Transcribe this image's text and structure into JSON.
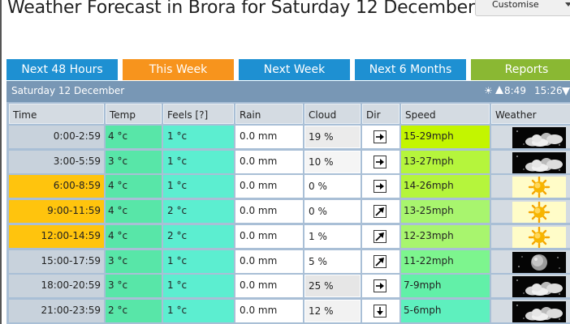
{
  "page": {
    "title": "Weather Forecast in Brora for Saturday 12 December",
    "customise_label": "Customise"
  },
  "tabs": [
    {
      "label": "Next 48 Hours",
      "color": "#1e90d2"
    },
    {
      "label": "This Week",
      "color": "#f7941d",
      "selected": true
    },
    {
      "label": "Next Week",
      "color": "#1e90d2"
    },
    {
      "label": "Next 6 Months",
      "color": "#1e90d2"
    },
    {
      "label": "Reports",
      "color": "#8ab833"
    }
  ],
  "day": {
    "title": "Saturday 12 December",
    "sunrise": "8:49",
    "sunset": "15:26"
  },
  "columns": [
    "Time",
    "Temp",
    "Feels [?]",
    "Rain",
    "Cloud",
    "Dir",
    "Speed",
    "Weather"
  ],
  "rows": [
    {
      "time": "0:00-2:59",
      "temp": "4 °c",
      "feels": "1 °c",
      "rain": "0.0 mm",
      "cloud": "19 %",
      "dir": "east",
      "speed": "15-29mph",
      "weather_icon": "cloudy-night-icon",
      "daylight": false,
      "cloud_color": "#ebebeb",
      "speed_color": "#c3f500"
    },
    {
      "time": "3:00-5:59",
      "temp": "3 °c",
      "feels": "1 °c",
      "rain": "0.0 mm",
      "cloud": "10 %",
      "dir": "east",
      "speed": "13-27mph",
      "weather_icon": "cloudy-night-icon",
      "daylight": false,
      "cloud_color": "#f5f5f5",
      "speed_color": "#b5f53c"
    },
    {
      "time": "6:00-8:59",
      "temp": "4 °c",
      "feels": "1 °c",
      "rain": "0.0 mm",
      "cloud": "0 %",
      "dir": "east",
      "speed": "14-26mph",
      "weather_icon": "sunny-icon",
      "daylight": true,
      "cloud_color": "#ffffff",
      "speed_color": "#b5f53c"
    },
    {
      "time": "9:00-11:59",
      "temp": "4 °c",
      "feels": "2 °c",
      "rain": "0.0 mm",
      "cloud": "0 %",
      "dir": "northeast",
      "speed": "13-25mph",
      "weather_icon": "sunny-icon",
      "daylight": true,
      "cloud_color": "#ffffff",
      "speed_color": "#a8f56e"
    },
    {
      "time": "12:00-14:59",
      "temp": "4 °c",
      "feels": "2 °c",
      "rain": "0.0 mm",
      "cloud": "1 %",
      "dir": "northeast",
      "speed": "12-23mph",
      "weather_icon": "sunny-icon",
      "daylight": true,
      "cloud_color": "#ffffff",
      "speed_color": "#a8f56e"
    },
    {
      "time": "15:00-17:59",
      "temp": "3 °c",
      "feels": "1 °c",
      "rain": "0.0 mm",
      "cloud": "5 %",
      "dir": "northeast",
      "speed": "11-22mph",
      "weather_icon": "clear-night-icon",
      "daylight": false,
      "cloud_color": "#ffffff",
      "speed_color": "#7df58e"
    },
    {
      "time": "18:00-20:59",
      "temp": "3 °c",
      "feels": "1 °c",
      "rain": "0.0 mm",
      "cloud": "25 %",
      "dir": "east",
      "speed": "7-9mph",
      "weather_icon": "cloudy-night-icon",
      "daylight": false,
      "cloud_color": "#e6e6e6",
      "speed_color": "#62f0a8"
    },
    {
      "time": "21:00-23:59",
      "temp": "2 °c",
      "feels": "1 °c",
      "rain": "0.0 mm",
      "cloud": "12 %",
      "dir": "south",
      "speed": "5-6mph",
      "weather_icon": "cloudy-night-icon",
      "daylight": false,
      "cloud_color": "#f2f2f2",
      "speed_color": "#5ef0be"
    }
  ]
}
